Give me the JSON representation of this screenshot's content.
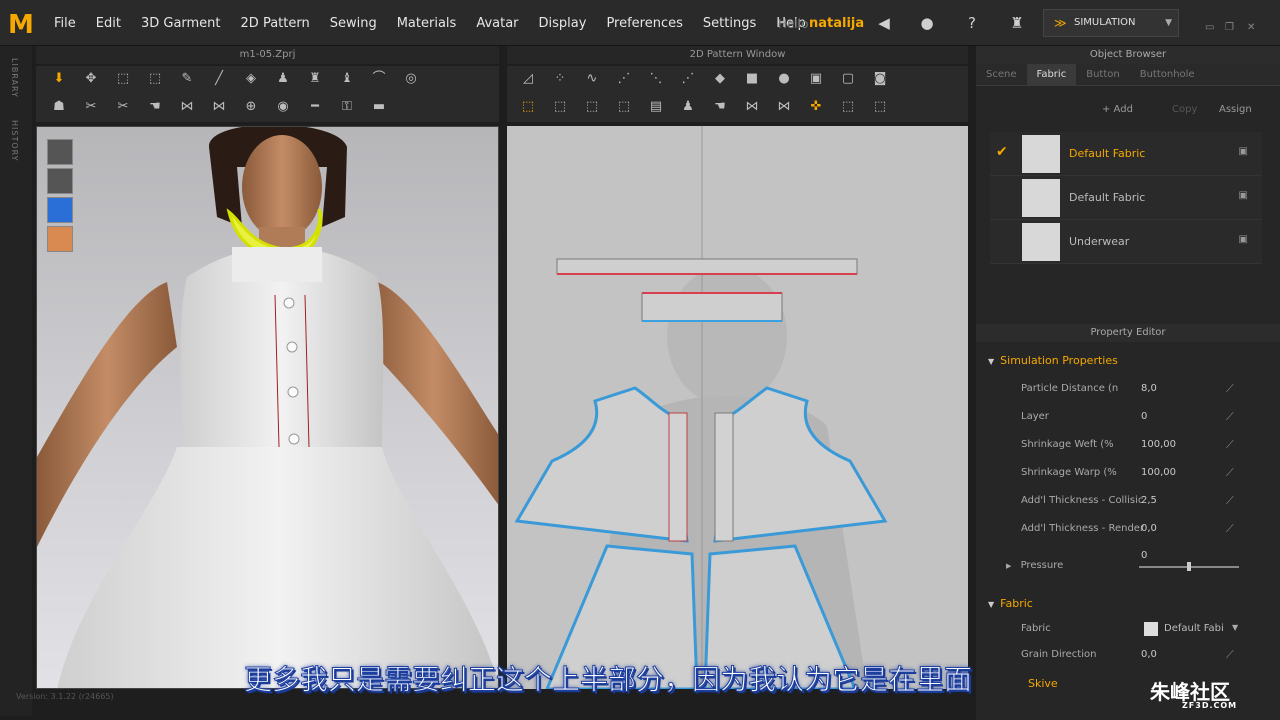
{
  "app": {
    "logo": "M",
    "hello": "Hello",
    "user": "natalija",
    "sim_label": "SIMULATION"
  },
  "menu": [
    "File",
    "Edit",
    "3D Garment",
    "2D Pattern",
    "Sewing",
    "Materials",
    "Avatar",
    "Display",
    "Preferences",
    "Settings",
    "Help"
  ],
  "sidebar": {
    "library": "LIBRARY",
    "history": "HISTORY"
  },
  "view3d": {
    "title": "m1-05.Zprj"
  },
  "view2d": {
    "title": "2D Pattern Window"
  },
  "object_browser": {
    "title": "Object Browser",
    "tabs": [
      "Scene",
      "Fabric",
      "Button",
      "Buttonhole"
    ],
    "active_tab": "Fabric",
    "add": "+ Add",
    "copy": "Copy",
    "assign": "Assign",
    "fabrics": [
      {
        "name": "Default Fabric",
        "selected": true
      },
      {
        "name": "Default Fabric",
        "selected": false
      },
      {
        "name": "Underwear",
        "selected": false
      }
    ]
  },
  "property_editor": {
    "title": "Property Editor",
    "sim_section": "Simulation Properties",
    "props": [
      {
        "label": "Particle Distance (n",
        "value": "8,0"
      },
      {
        "label": "Layer",
        "value": "0"
      },
      {
        "label": "Shrinkage Weft (%",
        "value": "100,00"
      },
      {
        "label": "Shrinkage Warp (%",
        "value": "100,00"
      },
      {
        "label": "Add'l Thickness - Collisic",
        "value": "2,5"
      },
      {
        "label": "Add'l Thickness - Render",
        "value": "0,0"
      }
    ],
    "pressure_label": "Pressure",
    "pressure_value": "0",
    "fabric_section": "Fabric",
    "fabric_label": "Fabric",
    "fabric_value": "Default Fabi",
    "grain_label": "Grain Direction",
    "grain_value": "0,0",
    "skive_label": "Skive"
  },
  "version": "Version: 3.1.22    (r24665)",
  "subtitle": "更多我只是需要纠正这个上半部分，因为我认为它是在里面",
  "watermark": {
    "main": "朱峰社区",
    "sub": "ZF3D.COM"
  }
}
